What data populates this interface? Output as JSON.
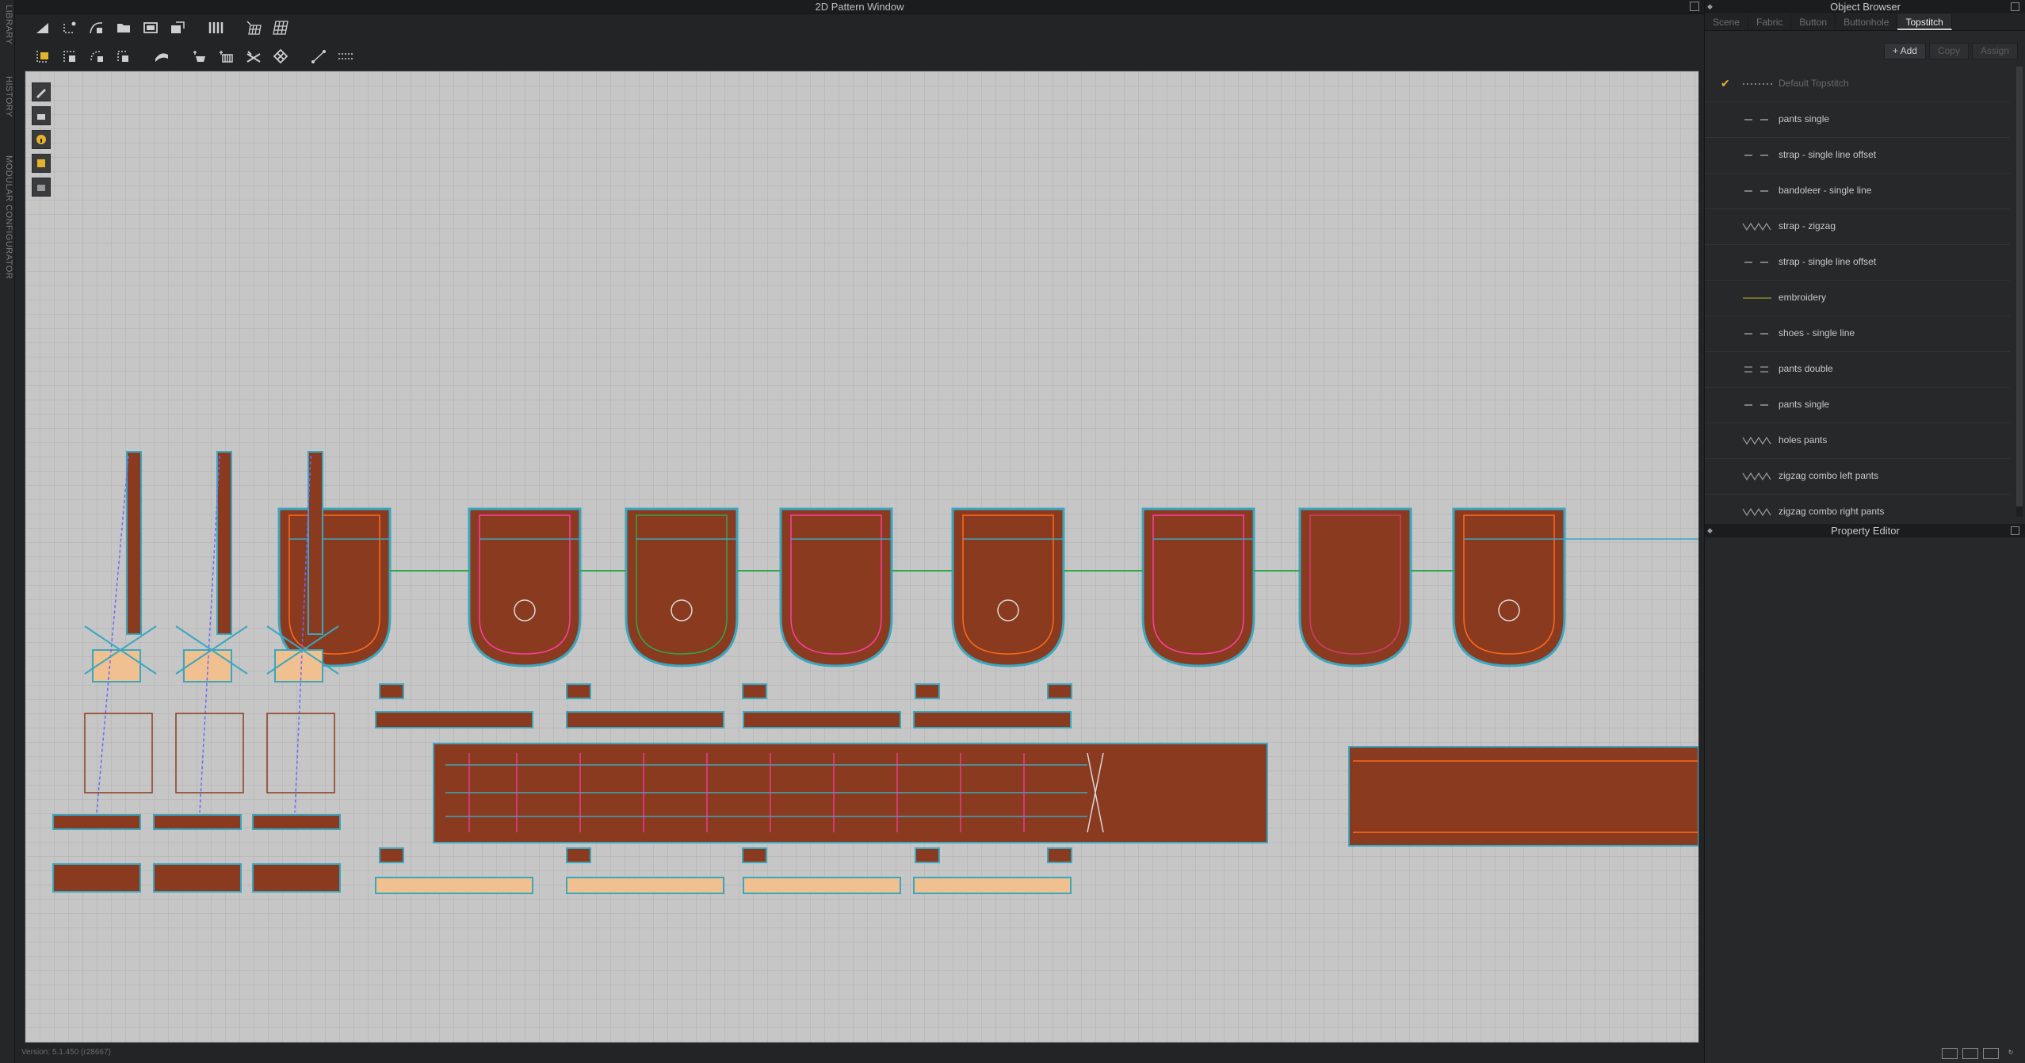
{
  "left_tabs": [
    "LIBRARY",
    "HISTORY",
    "MODULAR CONFIGURATOR"
  ],
  "pattern_window": {
    "title": "2D Pattern Window",
    "toolbar_row1": [
      "transform-pattern-icon",
      "edit-point-icon",
      "edit-curvature-icon",
      "rectangle-icon",
      "polygon-icon",
      "internal-rectangle-icon",
      "internal-polygon-icon",
      "segment-sewing-icon",
      "grid-icon",
      "texture-grid-icon"
    ],
    "toolbar_row2": [
      "select-seam-icon",
      "segment-seam-icon",
      "free-seam-icon",
      "m-n-seam-icon",
      "tack-icon",
      "pin-icon",
      "fold-icon",
      "trim-icon",
      "button-icon",
      "measure-icon",
      "tape-icon"
    ],
    "side_tools": [
      "pen-tool-icon",
      "eraser-tool-icon",
      "info-tool-icon",
      "fold-tool-icon",
      "camera-tool-icon"
    ]
  },
  "version": "Version: 5.1.450 (r28667)",
  "colors": {
    "fabric": "#8a3a1f",
    "fabric_light": "#f0c090",
    "outline": "#3aa7c0",
    "seam_pink": "#ff3da6",
    "seam_orange": "#ff6a1a",
    "seam_green": "#2ea84b",
    "accent_check": "#e5b22c"
  },
  "object_browser": {
    "title": "Object Browser",
    "tabs": [
      "Scene",
      "Fabric",
      "Button",
      "Buttonhole",
      "Topstitch"
    ],
    "active_tab": "Topstitch",
    "buttons": [
      {
        "label": "+ Add",
        "enabled": true
      },
      {
        "label": "Copy",
        "enabled": false
      },
      {
        "label": "Assign",
        "enabled": false
      }
    ],
    "topstitches": [
      {
        "name": "Default Topstitch",
        "line": "dotted",
        "checked": true
      },
      {
        "name": "pants single",
        "line": "dash"
      },
      {
        "name": "strap - single line offset",
        "line": "dash"
      },
      {
        "name": "bandoleer - single line",
        "line": "dash"
      },
      {
        "name": "strap - zigzag",
        "line": "zigzag"
      },
      {
        "name": "strap - single line offset",
        "line": "dash"
      },
      {
        "name": "embroidery",
        "line": "solid-olive"
      },
      {
        "name": "shoes - single line",
        "line": "dash"
      },
      {
        "name": "pants double",
        "line": "double-dash"
      },
      {
        "name": "pants single",
        "line": "dash"
      },
      {
        "name": "holes pants",
        "line": "zigzag"
      },
      {
        "name": "zigzag combo left pants",
        "line": "zigzag"
      },
      {
        "name": "zigzag combo right pants",
        "line": "zigzag"
      }
    ]
  },
  "property_editor": {
    "title": "Property Editor"
  }
}
